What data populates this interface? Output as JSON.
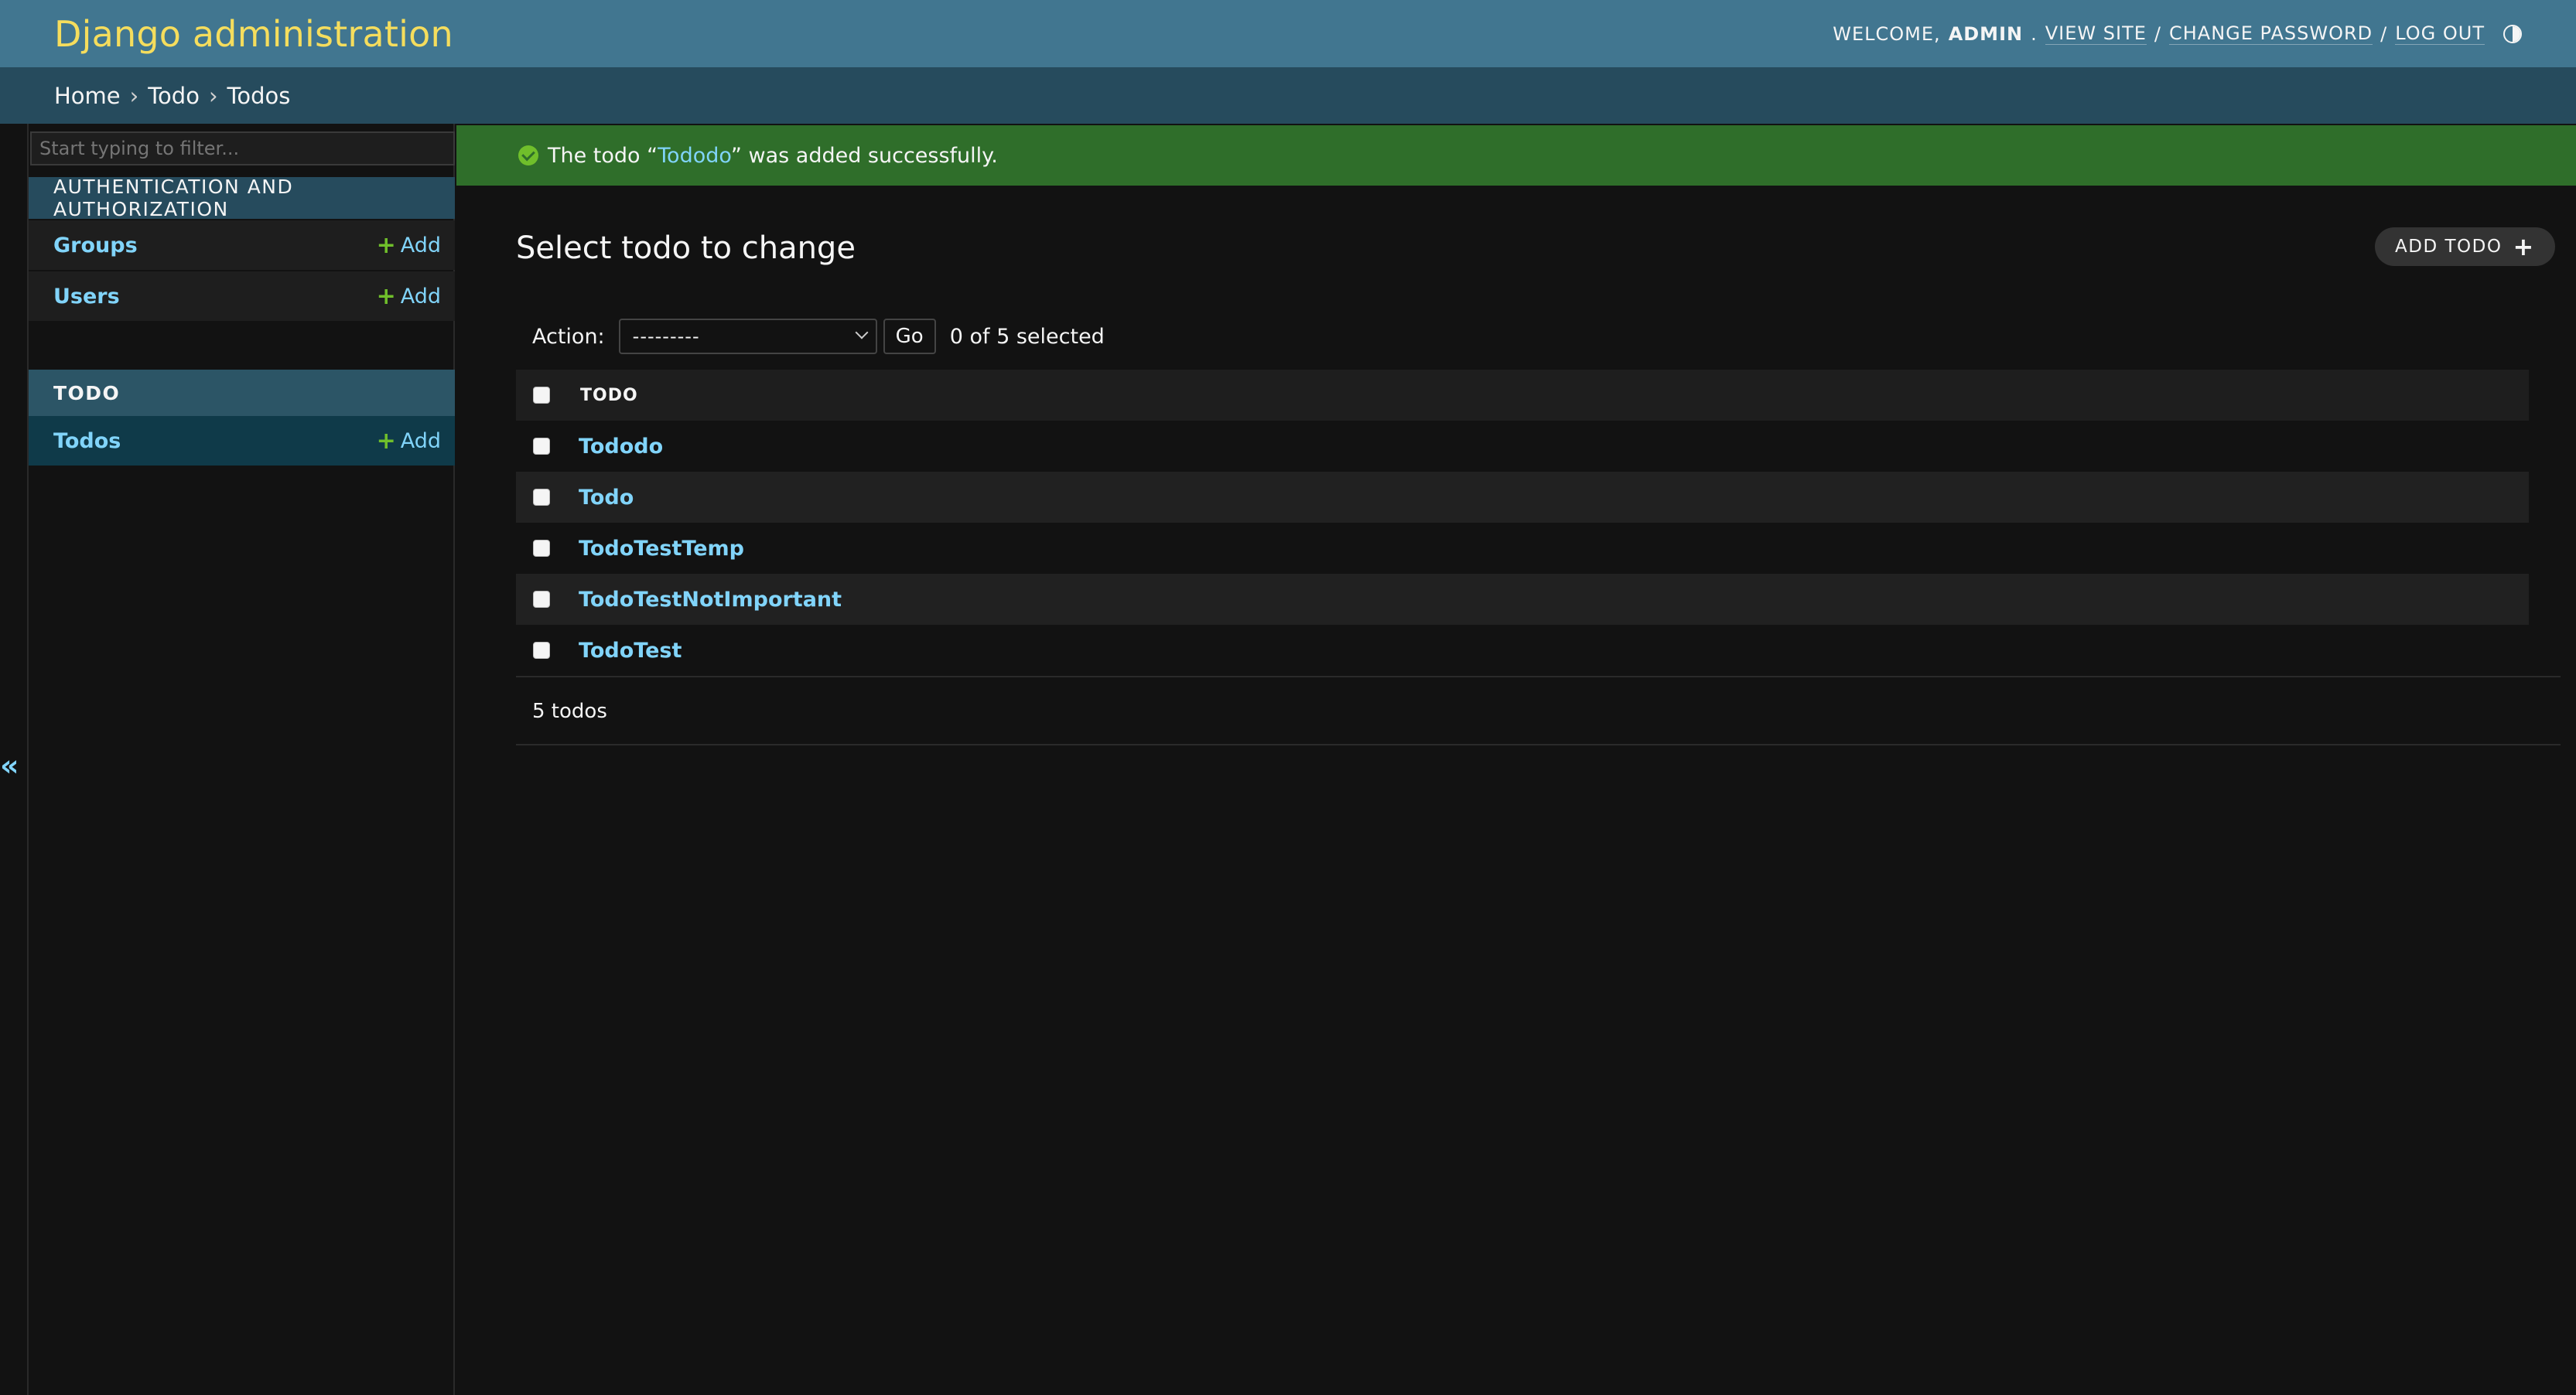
{
  "header": {
    "branding": "Django administration",
    "welcome": "WELCOME,",
    "username": "ADMIN",
    "view_site": "VIEW SITE",
    "change_password": "CHANGE PASSWORD",
    "log_out": "LOG OUT",
    "sep": "/",
    "period": "."
  },
  "breadcrumbs": {
    "items": [
      "Home",
      "Todo",
      "Todos"
    ],
    "sep": "›"
  },
  "sidebar": {
    "filter_placeholder": "Start typing to filter...",
    "apps": [
      {
        "caption": "AUTHENTICATION AND AUTHORIZATION",
        "models": [
          {
            "name": "Groups",
            "add": "Add"
          },
          {
            "name": "Users",
            "add": "Add"
          }
        ]
      },
      {
        "caption": "TODO",
        "models": [
          {
            "name": "Todos",
            "add": "Add"
          }
        ]
      }
    ],
    "toggle": "«"
  },
  "message": {
    "prefix": "The todo “",
    "link": "Tododo",
    "suffix": "” was added successfully."
  },
  "content": {
    "title": "Select todo to change",
    "add_button": "ADD TODO",
    "action_label": "Action:",
    "action_selected": "---------",
    "go_label": "Go",
    "selection_counter": "0 of 5 selected",
    "column_header": "TODO",
    "rows": [
      "Tododo",
      "Todo",
      "TodoTestTemp",
      "TodoTestNotImportant",
      "TodoTest"
    ],
    "paginator": "5 todos"
  },
  "colors": {
    "header_bg": "#417690",
    "branding": "#f5dd5d",
    "breadcrumbs_bg": "#264b5d",
    "link": "#81d4fa",
    "success_bg": "#2f6e2a",
    "add_green": "#70bf2b",
    "body_bg": "#121212"
  }
}
